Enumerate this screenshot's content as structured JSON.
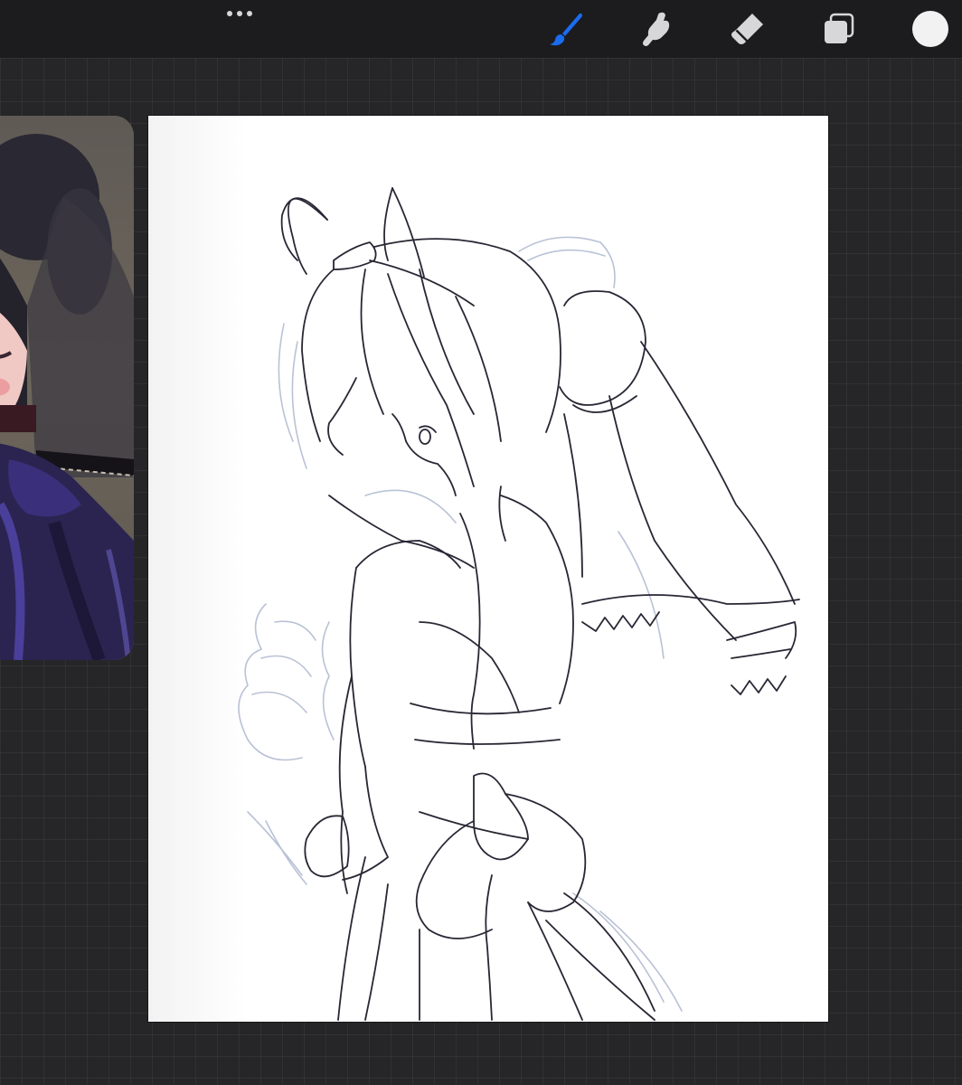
{
  "toolbar": {
    "more_icon": "ellipsis-icon",
    "tools": [
      {
        "name": "brush",
        "icon": "brush-icon",
        "active": true
      },
      {
        "name": "smudge",
        "icon": "smudge-finger-icon",
        "active": false
      },
      {
        "name": "eraser",
        "icon": "eraser-icon",
        "active": false
      },
      {
        "name": "layers",
        "icon": "layers-icon",
        "active": false
      }
    ],
    "current_color": "#f2f2f2",
    "accent_color": "#1a6cf0"
  },
  "reference": {
    "icon": "reference-image",
    "description_icon": "character-reference-thumbnail"
  },
  "canvas": {
    "icon": "drawing-canvas",
    "background_color": "#ffffff",
    "line_color": "#2a2634",
    "sketch_color": "#b9c2d6"
  }
}
